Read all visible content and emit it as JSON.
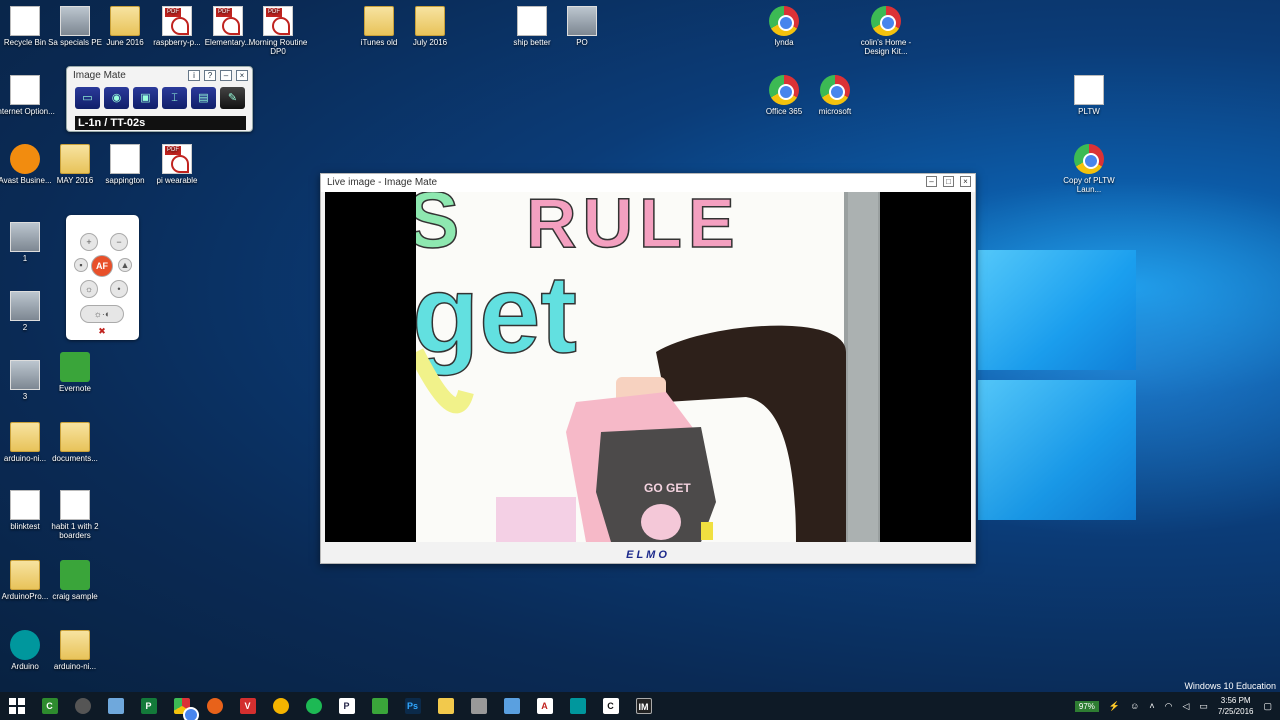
{
  "desktop_icons": [
    {
      "label": "Recycle Bin",
      "kind": "recycle"
    },
    {
      "label": "Sa specials PE",
      "kind": "thumb"
    },
    {
      "label": "June 2016",
      "kind": "folder"
    },
    {
      "label": "raspberry-p...",
      "kind": "pdf"
    },
    {
      "label": "Elementary...",
      "kind": "pdf"
    },
    {
      "label": "Morning Routine DP0",
      "kind": "pdf"
    },
    {
      "label": "iTunes old",
      "kind": "folder"
    },
    {
      "label": "July 2016",
      "kind": "folder"
    },
    {
      "label": "ship better",
      "kind": "doc"
    },
    {
      "label": "PO",
      "kind": "thumb"
    },
    {
      "label": "lynda",
      "kind": "chrome"
    },
    {
      "label": "colin's Home - Design Kit...",
      "kind": "chrome"
    },
    {
      "label": "Internet Option...",
      "kind": "doc"
    },
    {
      "label": "Office 365",
      "kind": "chrome"
    },
    {
      "label": "microsoft",
      "kind": "chrome"
    },
    {
      "label": "PLTW",
      "kind": "doc"
    },
    {
      "label": "Avast Busine...",
      "kind": "orange"
    },
    {
      "label": "MAY 2016",
      "kind": "folder"
    },
    {
      "label": "sappington",
      "kind": "doc"
    },
    {
      "label": "pi wearable",
      "kind": "pdf"
    },
    {
      "label": "Copy of PLTW Laun...",
      "kind": "chrome"
    },
    {
      "label": "1",
      "kind": "thumb"
    },
    {
      "label": "2",
      "kind": "thumb"
    },
    {
      "label": "3",
      "kind": "thumb"
    },
    {
      "label": "Evernote",
      "kind": "green"
    },
    {
      "label": "arduino-ni...",
      "kind": "folder"
    },
    {
      "label": "documents...",
      "kind": "folder"
    },
    {
      "label": "blinktest",
      "kind": "doc"
    },
    {
      "label": "habit 1 with 2 boarders",
      "kind": "doc"
    },
    {
      "label": "ArduinoPro...",
      "kind": "folder"
    },
    {
      "label": "craig sample",
      "kind": "green"
    },
    {
      "label": "Arduino",
      "kind": "teal"
    },
    {
      "label": "arduino-ni...",
      "kind": "folder"
    }
  ],
  "image_mate_bar": {
    "title": "Image Mate",
    "controls": [
      "i",
      "?",
      "–",
      "×"
    ],
    "model": "L-1n / TT-02s"
  },
  "camera_widget": {
    "af_label": "AF"
  },
  "live_window": {
    "title": "Live image - Image Mate",
    "brand": "ELMO",
    "photo_text": [
      "S",
      "RULE",
      "get",
      "GO GET"
    ]
  },
  "taskbar": {
    "tray": {
      "battery": "97%",
      "time": "3:56 PM",
      "date": "7/25/2016"
    }
  },
  "edition": "Windows 10 Education",
  "colors": {
    "accent": "#1d2a8c",
    "af": "#e8502a"
  }
}
